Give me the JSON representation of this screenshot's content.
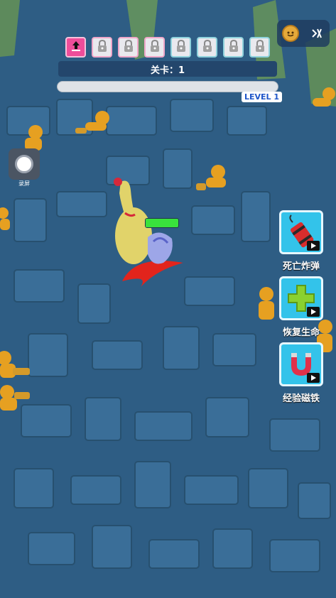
{
  "hud": {
    "level_text": "关卡：1",
    "level_tag": "LEVEL 1",
    "progress": 0.0,
    "record_label": "录屏",
    "skill_slots": [
      {
        "state": "active",
        "icon": "upgrade-icon"
      },
      {
        "state": "locked",
        "icon": "lock-icon"
      },
      {
        "state": "locked",
        "icon": "lock-icon"
      },
      {
        "state": "locked",
        "icon": "lock-icon"
      },
      {
        "state": "locked",
        "icon": "lock-icon"
      },
      {
        "state": "locked",
        "icon": "lock-icon"
      },
      {
        "state": "locked",
        "icon": "lock-icon"
      },
      {
        "state": "locked",
        "icon": "lock-icon"
      }
    ]
  },
  "powerups": [
    {
      "label": "死亡炸弹",
      "icon": "dynamite-icon"
    },
    {
      "label": "恢复生命",
      "icon": "heal-plus-icon"
    },
    {
      "label": "经验磁铁",
      "icon": "magnet-icon"
    }
  ],
  "player": {
    "health": 1.0
  },
  "colors": {
    "floor": "#2f5f86",
    "tile": "#3a6f99",
    "accent_pink": "#ef4d9a",
    "health": "#39e23c",
    "enemy": "#e6a021"
  }
}
